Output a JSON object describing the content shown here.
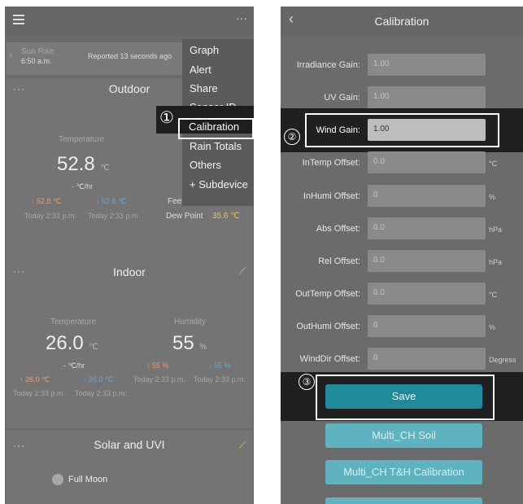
{
  "left": {
    "menu_icon": "hamburger-icon",
    "more_icon": "more-icon",
    "sun": {
      "label": "Sun Rise",
      "time": "6:50 a.m.",
      "reported": "Reported 13 seconds ago"
    },
    "outdoor": {
      "title": "Outdoor",
      "temp_label": "Temperature",
      "temp_value": "52.8",
      "temp_unit": "℃",
      "rate": "- ℃/hr",
      "high": "↑ 52.8 ℃",
      "low": "↓ 52.8 ℃",
      "high_time": "Today 2:33 p.m.",
      "low_time": "Today 2:33 p.m.",
      "feel": "Feel",
      "dew_label": "Dew Point",
      "dew_value": "35.6 ℃"
    },
    "indoor": {
      "title": "Indoor",
      "temp_label": "Temperature",
      "temp_value": "26.0",
      "temp_unit": "℃",
      "hum_label": "Humidity",
      "hum_value": "55",
      "hum_unit": "%",
      "rate": "- ℃/hr",
      "temp_high": "↑ 26.0 ℃",
      "temp_low": "↓ 26.0 ℃",
      "hum_high": "↑ 55 %",
      "hum_low": "↓ 55 %",
      "t1": "Today 2:33 p.m.",
      "t2": "Today 2:33 p.m.",
      "t3": "Today 2:33 p.m.",
      "t4": "Today 2:33 p.m."
    },
    "solar": {
      "title": "Solar and UVI",
      "moon": "Full Moon"
    },
    "menu": [
      "Graph",
      "Alert",
      "Share",
      "Sensor ID",
      "Calibration",
      "Rain Totals",
      "Others",
      "+ Subdevice"
    ],
    "step1": "①"
  },
  "right": {
    "title": "Calibration",
    "back_icon": "back-chevron-icon",
    "rows": [
      {
        "label": "Irradiance Gain:",
        "value": "1.00",
        "unit": ""
      },
      {
        "label": "UV Gain:",
        "value": "1.00",
        "unit": ""
      },
      {
        "label": "Wind Gain:",
        "value": "1.00",
        "unit": ""
      },
      {
        "label": "InTemp Offset:",
        "value": "0.0",
        "unit": "°C"
      },
      {
        "label": "InHumi Offset:",
        "value": "0",
        "unit": "%"
      },
      {
        "label": "Abs Offset:",
        "value": "0.0",
        "unit": "hPa"
      },
      {
        "label": "Rel Offset:",
        "value": "0.0",
        "unit": "hPa"
      },
      {
        "label": "OutTemp Offset:",
        "value": "0.0",
        "unit": "°C"
      },
      {
        "label": "OutHumi Offset:",
        "value": "0",
        "unit": "%"
      },
      {
        "label": "WindDir Offset:",
        "value": "0",
        "unit": "Degress"
      }
    ],
    "step2": "②",
    "step3": "③",
    "save": "Save",
    "multi_soil": "Multi_CH Soil",
    "multi_th": "Multi_CH T&H Calibration"
  },
  "colors": {
    "teal_dark": "#1f8a9a",
    "teal_light": "#5fb3c0",
    "orange": "#e8a070",
    "blue": "#6aa7d4",
    "yellow": "#e6c64a"
  }
}
